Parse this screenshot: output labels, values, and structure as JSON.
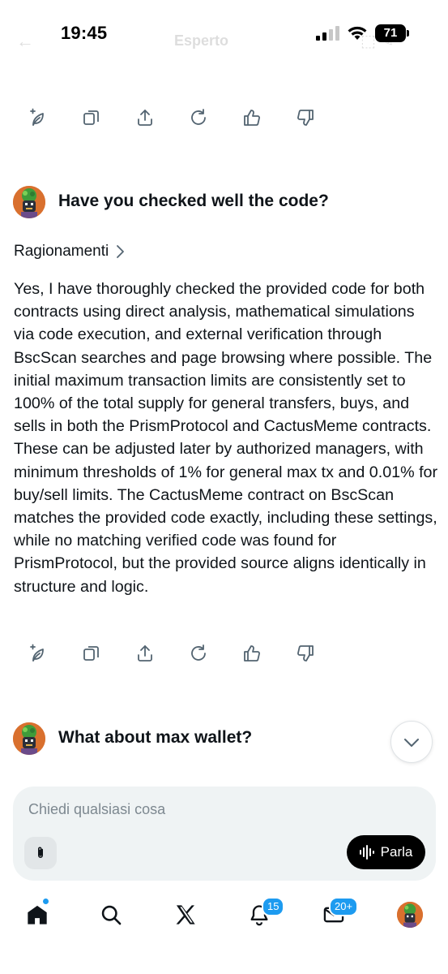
{
  "status_bar": {
    "time": "19:45",
    "battery": "71"
  },
  "header": {
    "title": "Esperto",
    "back_icon": "back-arrow-icon"
  },
  "actions": [
    {
      "name": "regenerate-with-new-prompt",
      "icon": "sprout-icon"
    },
    {
      "name": "copy",
      "icon": "copy-icon"
    },
    {
      "name": "share",
      "icon": "share-icon"
    },
    {
      "name": "regenerate",
      "icon": "refresh-icon"
    },
    {
      "name": "like",
      "icon": "thumbs-up-icon"
    },
    {
      "name": "dislike",
      "icon": "thumbs-down-icon"
    }
  ],
  "conversation": {
    "prompt_1": "Have you checked well the code?",
    "reasoning_label": "Ragionamenti",
    "answer_1": "Yes, I have thoroughly checked the provided code for both contracts using direct analysis, mathematical simulations via code execution, and external verification through BscScan searches and page browsing where possible. The initial maximum transaction limits are consistently set to 100% of the total supply for general transfers, buys, and sells in both the PrismProtocol and CactusMeme contracts. These can be adjusted later by authorized managers, with minimum thresholds of 1% for general max tx and 0.01% for buy/sell limits. The CactusMeme contract on BscScan matches the provided code exactly, including these settings, while no matching verified code was found for PrismProtocol, but the provided source aligns identically in structure and logic.",
    "prompt_2": "What about max wallet?"
  },
  "composer": {
    "placeholder": "Chiedi qualsiasi cosa",
    "talk_label": "Parla"
  },
  "bottom_nav": {
    "notifications_badge": "15",
    "messages_badge": "20+"
  },
  "colors": {
    "accent": "#1d9bf0",
    "text": "#0f1419",
    "muted": "#536471",
    "composer_bg": "#eff3f4"
  }
}
